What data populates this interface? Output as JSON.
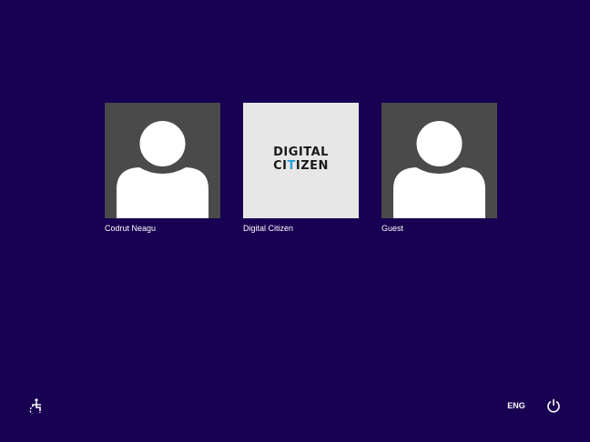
{
  "users": [
    {
      "name": "Codrut Neagu",
      "picture": "default-avatar"
    },
    {
      "name": "Digital Citizen",
      "picture": "digital-citizen-logo",
      "logo_line1": "DIGITAL",
      "logo_line2_a": "CI",
      "logo_line2_accent": "T",
      "logo_line2_b": "IZEN"
    },
    {
      "name": "Guest",
      "picture": "default-avatar"
    }
  ],
  "bottom_bar": {
    "ease_of_access_icon": "ease-of-access-icon",
    "language": "ENG",
    "power_icon": "power-icon"
  },
  "colors": {
    "background": "#180052",
    "avatar_background": "#4a4a4a",
    "logo_background": "#e7e7e7",
    "logo_accent": "#2aa0d8"
  }
}
